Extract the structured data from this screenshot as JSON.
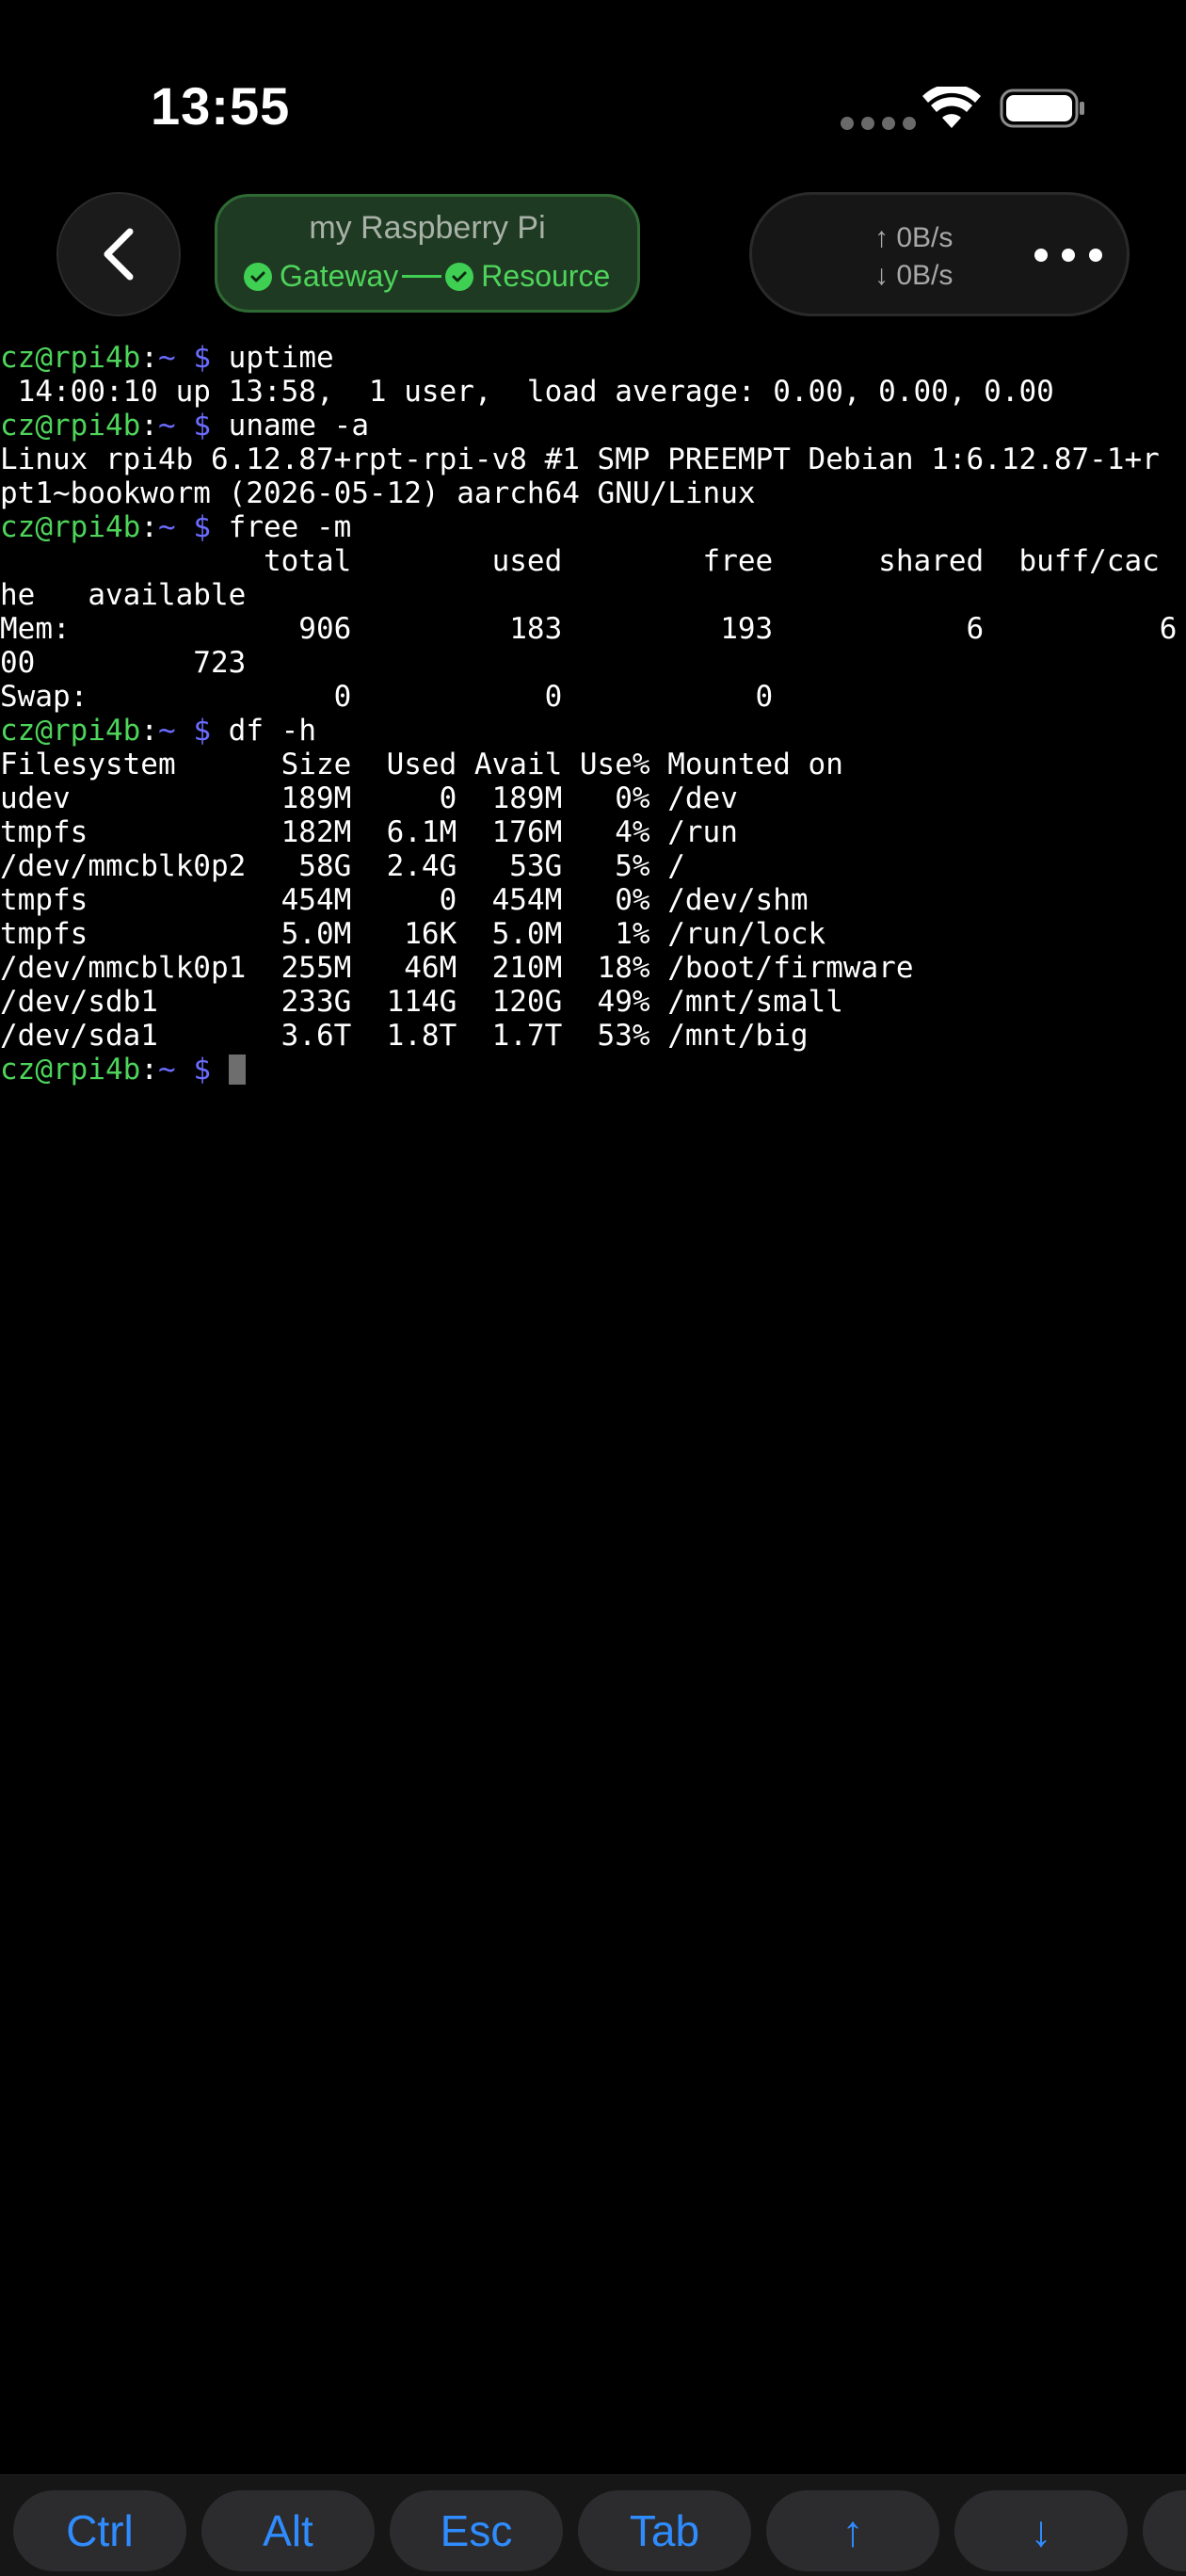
{
  "status_bar": {
    "time": "13:55"
  },
  "header": {
    "host_name": "my Raspberry Pi",
    "gateway_label": "Gateway",
    "resource_label": "Resource",
    "upload_rate": "↑ 0B/s",
    "download_rate": "↓ 0B/s"
  },
  "terminal": {
    "prompt": {
      "user_host": "cz@rpi4b",
      "sep": ":",
      "path": "~",
      "dollar": "$"
    },
    "commands": {
      "c1": "uptime",
      "c2": "uname -a",
      "c3": "free -m",
      "c4": "df -h"
    },
    "output": {
      "o1": " 14:00:10 up 13:58,  1 user,  load average: 0.00, 0.00, 0.00",
      "o2": "Linux rpi4b 6.12.87+rpt-rpi-v8 #1 SMP PREEMPT Debian 1:6.12.87-1+r",
      "o3": "pt1~bookworm (2026-05-12) aarch64 GNU/Linux",
      "o4": "               total        used        free      shared  buff/cac",
      "o5": "he   available",
      "o6": "Mem:             906         183         193           6          6",
      "o7": "00         723",
      "o8": "Swap:              0           0           0",
      "o9": "Filesystem      Size  Used Avail Use% Mounted on",
      "o10": "udev            189M     0  189M   0% /dev",
      "o11": "tmpfs           182M  6.1M  176M   4% /run",
      "o12": "/dev/mmcblk0p2   58G  2.4G   53G   5% /",
      "o13": "tmpfs           454M     0  454M   0% /dev/shm",
      "o14": "tmpfs           5.0M   16K  5.0M   1% /run/lock",
      "o15": "/dev/mmcblk0p1  255M   46M  210M  18% /boot/firmware",
      "o16": "/dev/sdb1       233G  114G  120G  49% /mnt/small",
      "o17": "/dev/sda1       3.6T  1.8T  1.7T  53% /mnt/big"
    }
  },
  "keys": {
    "ctrl": "Ctrl",
    "alt": "Alt",
    "esc": "Esc",
    "tab": "Tab",
    "up": "↑",
    "down": "↓"
  },
  "colors": {
    "prompt_user": "#4ed45b",
    "prompt_path": "#6b6cff",
    "key_text": "#2f8cff",
    "status_green": "#3fcf52"
  },
  "icons": {
    "back": "chevron-left-icon",
    "more": "more-horizontal-icon",
    "wifi": "wifi-icon",
    "battery": "battery-icon",
    "check": "check-circle-icon"
  }
}
